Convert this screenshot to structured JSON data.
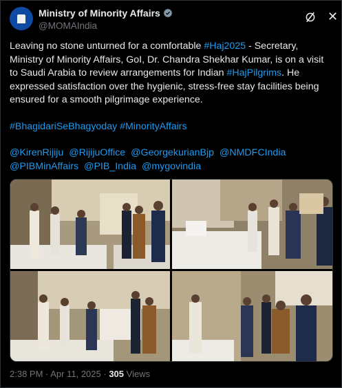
{
  "account": {
    "name": "Ministry of Minority Affairs",
    "handle": "@MOMAIndia"
  },
  "post": {
    "text_1": "Leaving no stone unturned for a comfortable ",
    "hashtag_haj": "#Haj2025",
    "text_2": " -  Secretary, Ministry of Minority Affairs, GoI,  Dr. Chandra Shekhar Kumar, is on a visit to Saudi Arabia to review arrangements for Indian ",
    "hashtag_pilgrims": "#HajPilgrims",
    "text_3": ". He expressed satisfaction over the hygienic, stress-free stay facilities being ensured for a smooth pilgrimage experience.",
    "hashtags": "#BhagidariSeBhagyoday #MinorityAffairs",
    "mentions": [
      "@KirenRijiju",
      "@RijijuOffice",
      "@GeorgekurianBjp",
      "@NMDFCIndia",
      "@PIBMinAffairs",
      "@PIB_India",
      "@mygovindia"
    ]
  },
  "footer": {
    "time": "2:38 PM",
    "date": "Apr 11, 2025",
    "views_count": "305",
    "views_label": "Views"
  },
  "icons": {
    "verified": "verified-badge-icon",
    "grok": "grok-icon",
    "close": "close-icon"
  },
  "colors": {
    "background": "#000000",
    "text": "#e7e9ea",
    "muted": "#71767b",
    "link": "#1d9bf0"
  }
}
